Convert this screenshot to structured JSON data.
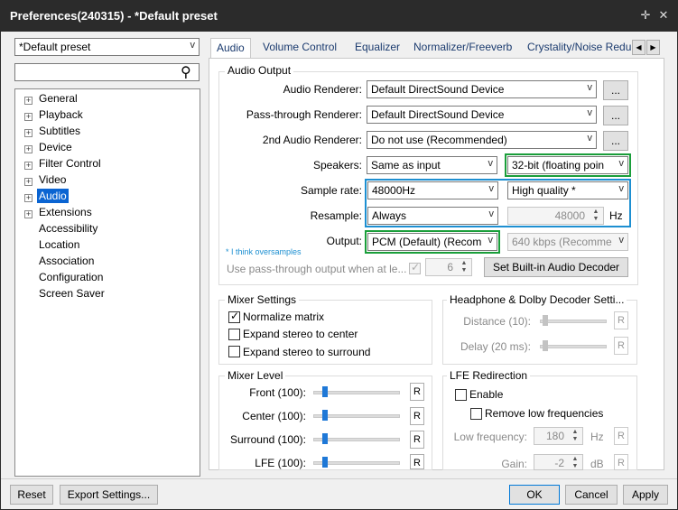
{
  "window": {
    "title": "Preferences(240315) - *Default preset"
  },
  "preset": {
    "value": "*Default preset"
  },
  "tree": [
    "General",
    "Playback",
    "Subtitles",
    "Device",
    "Filter Control",
    "Video",
    "Audio",
    "Extensions",
    "Accessibility",
    "Location",
    "Association",
    "Configuration",
    "Screen Saver"
  ],
  "tabs": [
    "Audio",
    "Volume Control",
    "Equalizer",
    "Normalizer/Freeverb",
    "Crystality/Noise Redu"
  ],
  "audio_output": {
    "group": "Audio Output",
    "renderer_label": "Audio Renderer:",
    "renderer_value": "Default DirectSound Device",
    "passthrough_label": "Pass-through Renderer:",
    "passthrough_value": "Default DirectSound Device",
    "second_label": "2nd Audio Renderer:",
    "second_value": "Do not use (Recommended)",
    "more": "...",
    "speakers_label": "Speakers:",
    "speakers_value": "Same as input",
    "format_value": "32-bit (floating poin",
    "samplerate_label": "Sample rate:",
    "samplerate_value": "48000Hz",
    "quality_value": "High quality  *",
    "resample_label": "Resample:",
    "resample_value": "Always",
    "resample_hz": "48000",
    "hz": "Hz",
    "output_label": "Output:",
    "output_value": "PCM (Default) (Recom",
    "bitrate_value": "640 kbps (Recomme",
    "note": "* I think oversamples",
    "passthrough_when": "Use pass-through output when at le...",
    "pt_count": "6",
    "builtin_decoder": "Set Built-in Audio Decoder"
  },
  "mixer": {
    "group": "Mixer Settings",
    "normalize": "Normalize matrix",
    "expand_center": "Expand stereo to center",
    "expand_surround": "Expand stereo to surround"
  },
  "headphone": {
    "group": "Headphone & Dolby Decoder Setti...",
    "distance": "Distance (10):",
    "delay": "Delay (20 ms):",
    "r": "R"
  },
  "mixer_level": {
    "group": "Mixer Level",
    "front": "Front (100):",
    "center": "Center (100):",
    "surround": "Surround (100):",
    "lfe": "LFE (100):",
    "r": "R"
  },
  "lfe": {
    "group": "LFE Redirection",
    "enable": "Enable",
    "remove_low": "Remove low frequencies",
    "low_freq": "Low frequency:",
    "low_freq_value": "180",
    "hz": "Hz",
    "gain": "Gain:",
    "gain_value": "-2",
    "db": "dB",
    "r": "R"
  },
  "footer": {
    "reset": "Reset",
    "export": "Export Settings...",
    "ok": "OK",
    "cancel": "Cancel",
    "apply": "Apply"
  },
  "highlight_colors": {
    "green": "#1a9e3a",
    "blue": "#1d8fd1"
  }
}
